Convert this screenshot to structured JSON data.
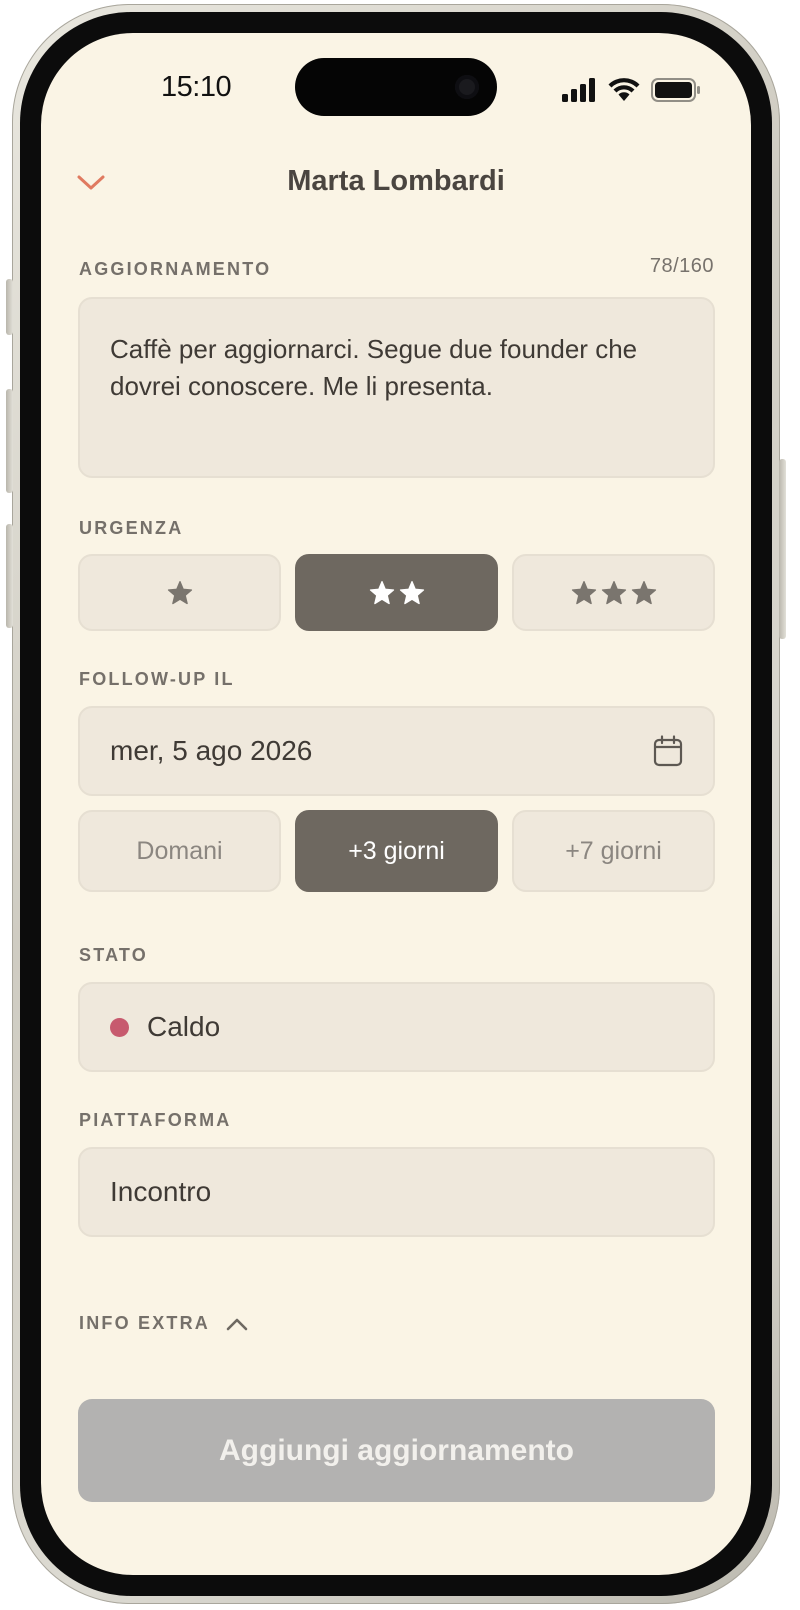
{
  "status_bar": {
    "time": "15:10",
    "icons": [
      "signal-icon",
      "wifi-icon",
      "battery-icon"
    ]
  },
  "header": {
    "title": "Marta Lombardi",
    "back_icon": "chevron-down-icon"
  },
  "update": {
    "label": "AGGIORNAMENTO",
    "counter": "78/160",
    "text": "Caffè per aggiornarci. Segue due founder che dovrei conoscere. Me li presenta."
  },
  "urgency": {
    "label": "URGENZA",
    "options": [
      {
        "stars": 1,
        "selected": false
      },
      {
        "stars": 2,
        "selected": true
      },
      {
        "stars": 3,
        "selected": false
      }
    ]
  },
  "followup": {
    "label": "FOLLOW-UP IL",
    "date": "mer, 5 ago 2026",
    "quick_options": [
      {
        "label": "Domani",
        "selected": false
      },
      {
        "label": "+3 giorni",
        "selected": true
      },
      {
        "label": "+7 giorni",
        "selected": false
      }
    ]
  },
  "status": {
    "label": "STATO",
    "value": "Caldo",
    "dot_color": "#c75a6e"
  },
  "platform": {
    "label": "PIATTAFORMA",
    "value": "Incontro"
  },
  "extra": {
    "label": "INFO EXTRA",
    "icon": "chevron-up-icon"
  },
  "submit": {
    "label": "Aggiungi aggiornamento",
    "enabled": false
  },
  "colors": {
    "accent": "#e07a60",
    "background": "#faf4e5",
    "field_bg": "#efe8dc",
    "active_segment": "#6e6860",
    "disabled_button": "#b3b2b1"
  }
}
